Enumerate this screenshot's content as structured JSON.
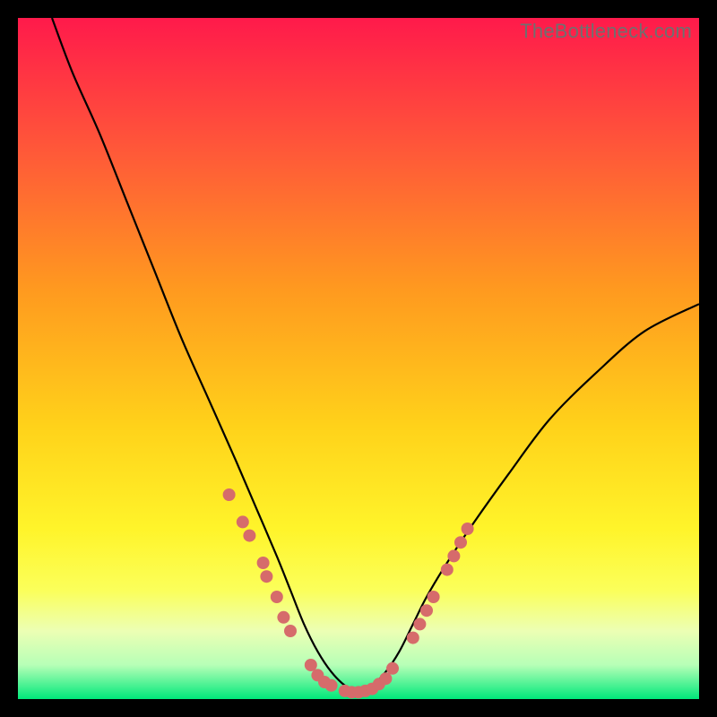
{
  "watermark": "TheBottleneck.com",
  "chart_data": {
    "type": "line",
    "title": "",
    "xlabel": "",
    "ylabel": "",
    "xlim": [
      0,
      100
    ],
    "ylim": [
      0,
      100
    ],
    "grid": false,
    "legend": false,
    "background_gradient": {
      "stops": [
        {
          "offset": 0.0,
          "color": "#ff1a4b"
        },
        {
          "offset": 0.2,
          "color": "#ff5a38"
        },
        {
          "offset": 0.4,
          "color": "#ff9a1f"
        },
        {
          "offset": 0.6,
          "color": "#ffd21a"
        },
        {
          "offset": 0.75,
          "color": "#fff42a"
        },
        {
          "offset": 0.84,
          "color": "#fbff5a"
        },
        {
          "offset": 0.9,
          "color": "#ecffb4"
        },
        {
          "offset": 0.95,
          "color": "#b7ffb7"
        },
        {
          "offset": 1.0,
          "color": "#00e87a"
        }
      ]
    },
    "series": [
      {
        "name": "bottleneck-curve",
        "color": "#000000",
        "x": [
          5,
          8,
          12,
          16,
          20,
          24,
          28,
          32,
          35,
          38,
          40,
          42,
          44,
          46,
          48,
          50,
          52,
          54,
          56,
          58,
          60,
          63,
          67,
          72,
          78,
          85,
          92,
          100
        ],
        "y": [
          100,
          92,
          83,
          73,
          63,
          53,
          44,
          35,
          28,
          21,
          16,
          11,
          7,
          4,
          2,
          1,
          2,
          4,
          7,
          11,
          15,
          20,
          26,
          33,
          41,
          48,
          54,
          58
        ]
      }
    ],
    "scatter": {
      "name": "highlight-dots",
      "color": "#d66b6b",
      "radius": 7,
      "points": [
        {
          "x": 31,
          "y": 30
        },
        {
          "x": 33,
          "y": 26
        },
        {
          "x": 34,
          "y": 24
        },
        {
          "x": 36,
          "y": 20
        },
        {
          "x": 36.5,
          "y": 18
        },
        {
          "x": 38,
          "y": 15
        },
        {
          "x": 39,
          "y": 12
        },
        {
          "x": 40,
          "y": 10
        },
        {
          "x": 43,
          "y": 5
        },
        {
          "x": 44,
          "y": 3.5
        },
        {
          "x": 45,
          "y": 2.5
        },
        {
          "x": 46,
          "y": 2
        },
        {
          "x": 48,
          "y": 1.2
        },
        {
          "x": 49,
          "y": 1
        },
        {
          "x": 50,
          "y": 1
        },
        {
          "x": 51,
          "y": 1.2
        },
        {
          "x": 52,
          "y": 1.5
        },
        {
          "x": 53,
          "y": 2.2
        },
        {
          "x": 54,
          "y": 3
        },
        {
          "x": 55,
          "y": 4.5
        },
        {
          "x": 58,
          "y": 9
        },
        {
          "x": 59,
          "y": 11
        },
        {
          "x": 60,
          "y": 13
        },
        {
          "x": 61,
          "y": 15
        },
        {
          "x": 63,
          "y": 19
        },
        {
          "x": 64,
          "y": 21
        },
        {
          "x": 65,
          "y": 23
        },
        {
          "x": 66,
          "y": 25
        }
      ]
    }
  }
}
